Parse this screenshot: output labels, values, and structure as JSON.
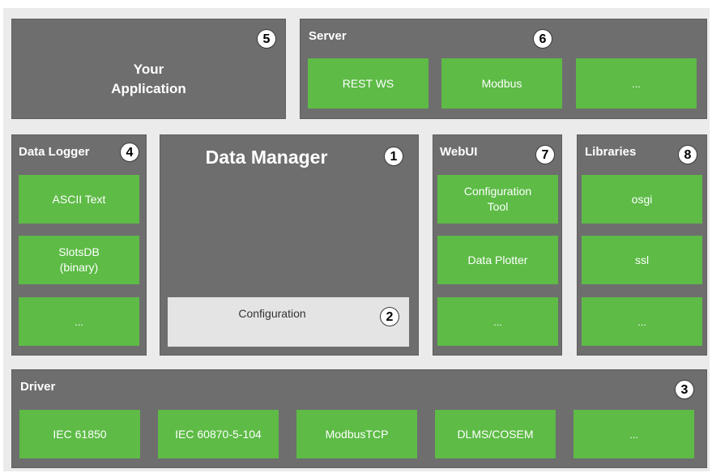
{
  "app": {
    "title_line1": "Your",
    "title_line2": "Application",
    "badge": "5"
  },
  "server": {
    "title": "Server",
    "badge": "6",
    "items": [
      "REST WS",
      "Modbus",
      "..."
    ]
  },
  "data_logger": {
    "title": "Data Logger",
    "badge": "4",
    "items": [
      "ASCII Text",
      "SlotsDB",
      "(binary)",
      "..."
    ]
  },
  "data_manager": {
    "title": "Data Manager",
    "badge": "1",
    "config_label": "Configuration",
    "config_badge": "2"
  },
  "webui": {
    "title": "WebUI",
    "badge": "7",
    "items": [
      "Configuration",
      "Tool",
      "Data Plotter",
      "..."
    ]
  },
  "libraries": {
    "title": "Libraries",
    "badge": "8",
    "items": [
      "osgi",
      "ssl",
      "..."
    ]
  },
  "driver": {
    "title": "Driver",
    "badge": "3",
    "items": [
      "IEC 61850",
      "IEC 60870-5-104",
      "ModbusTCP",
      "DLMS/COSEM",
      "..."
    ]
  },
  "colors": {
    "box_gray": "#6e6e6e",
    "item_green": "#5dbb46",
    "background": "#ebebeb",
    "config_gray": "#e4e4e4"
  }
}
